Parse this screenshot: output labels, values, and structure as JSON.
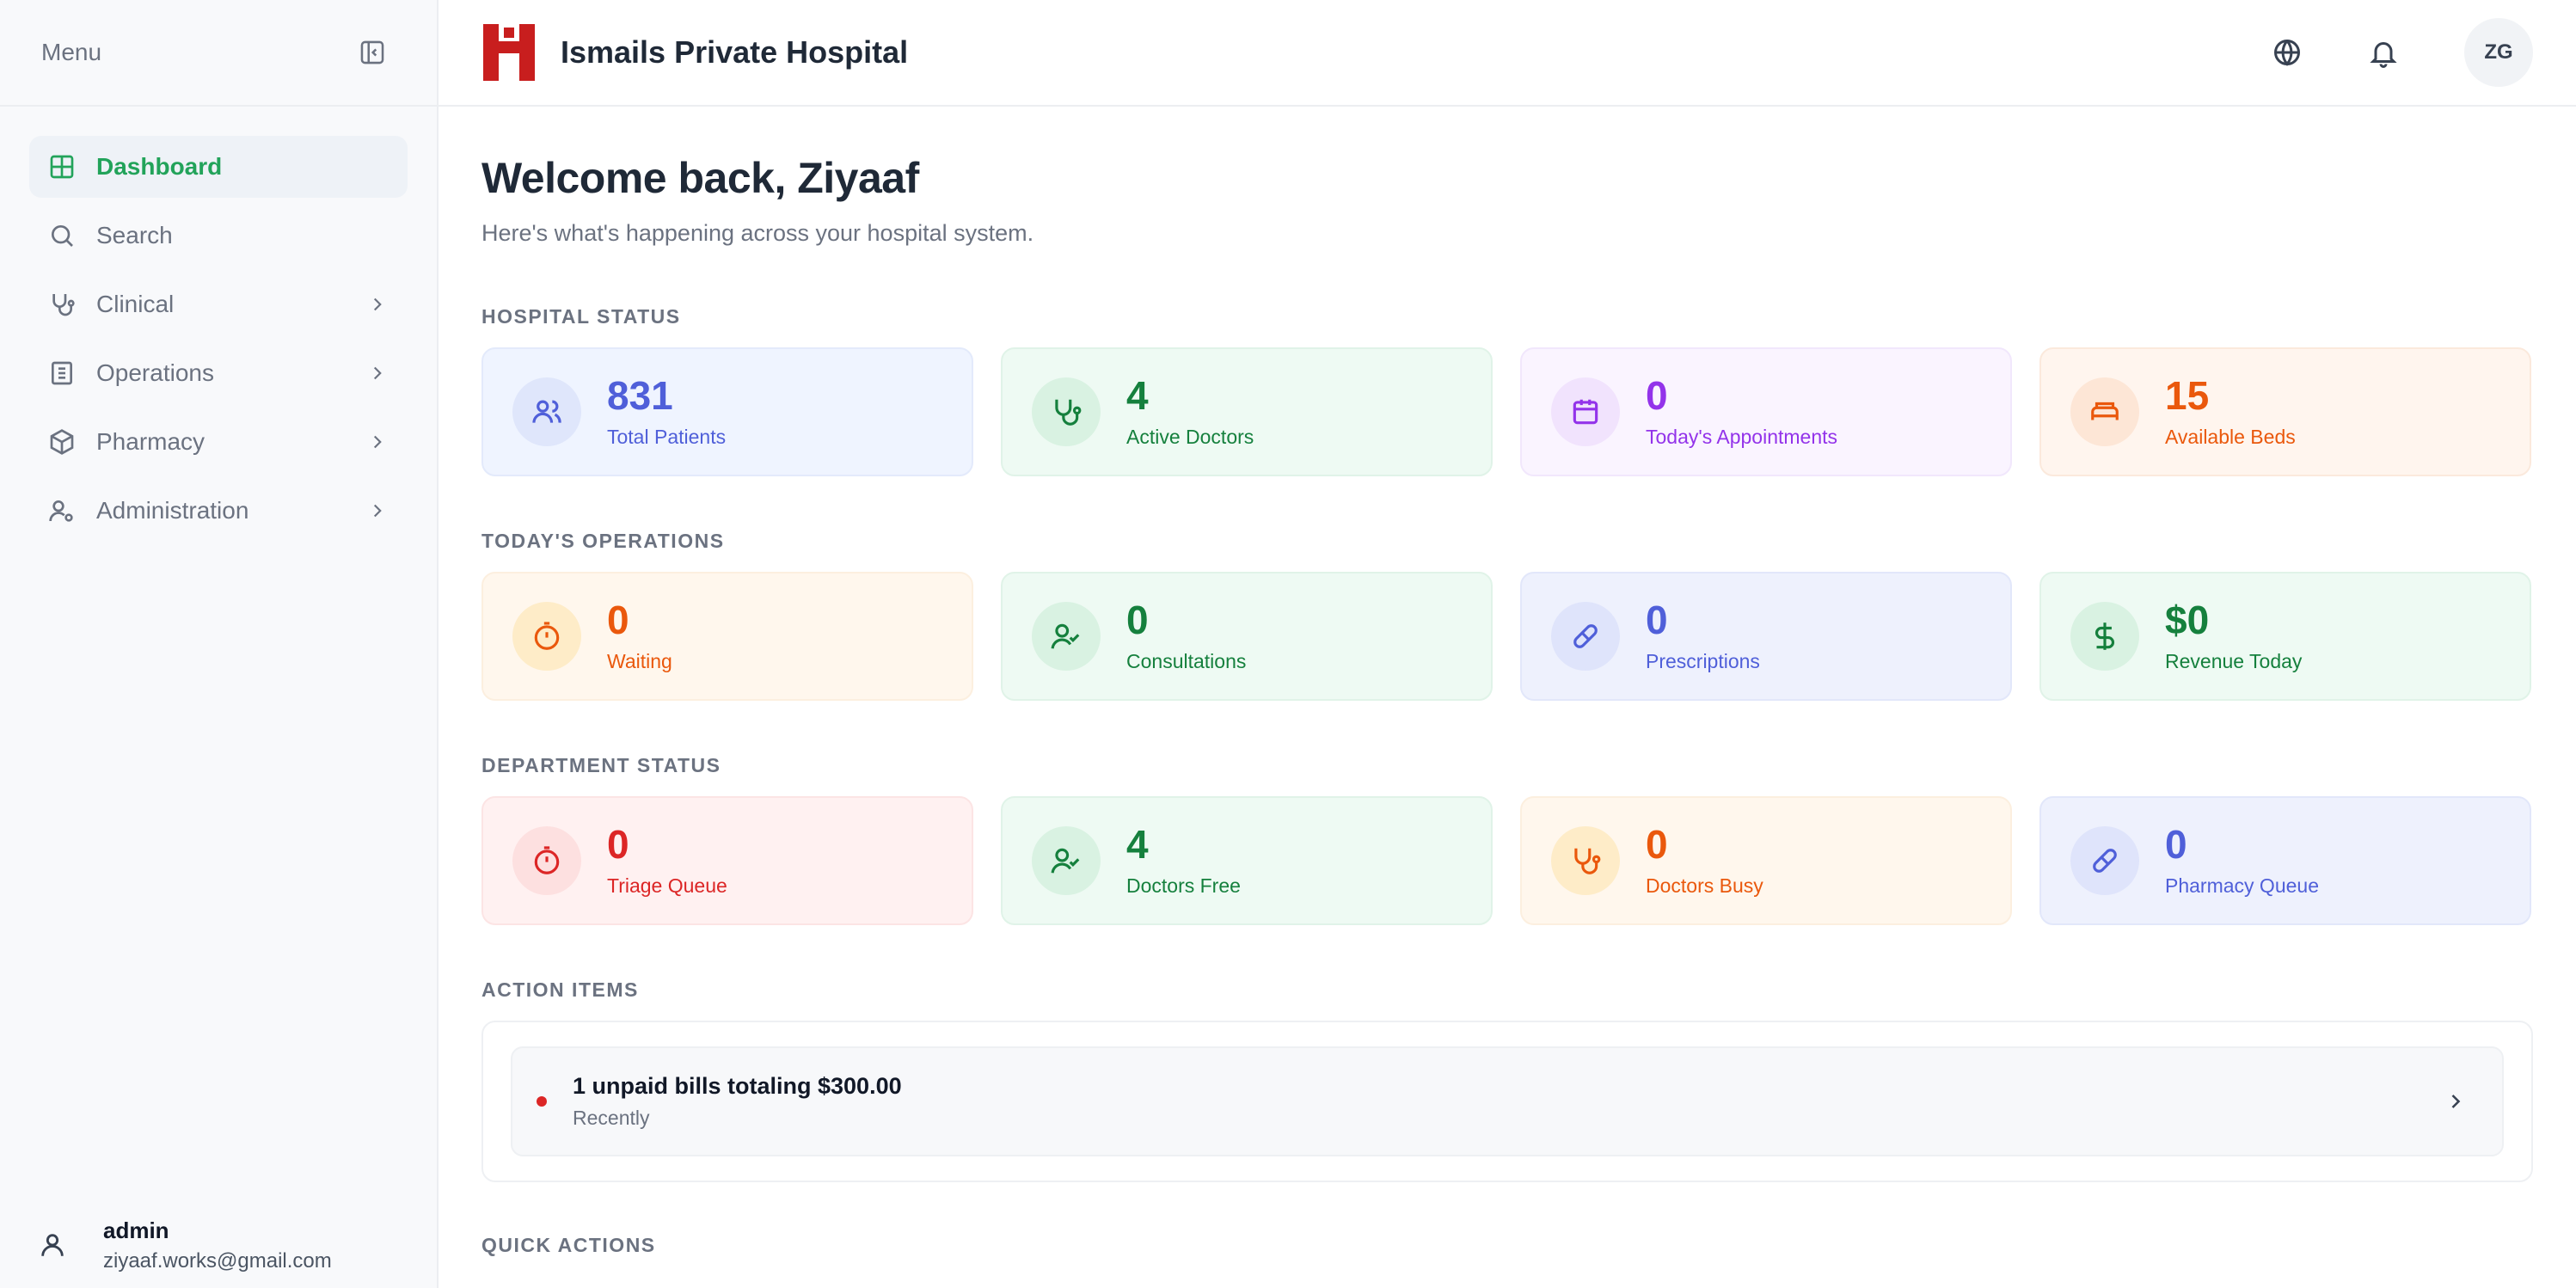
{
  "sidebar": {
    "menu_label": "Menu",
    "items": [
      {
        "label": "Dashboard",
        "icon": "dashboard-icon",
        "active": true
      },
      {
        "label": "Search",
        "icon": "search-icon"
      },
      {
        "label": "Clinical",
        "icon": "stethoscope-icon"
      },
      {
        "label": "Operations",
        "icon": "building-icon"
      },
      {
        "label": "Pharmacy",
        "icon": "box-icon"
      },
      {
        "label": "Administration",
        "icon": "user-cog-icon"
      }
    ],
    "user": {
      "name": "admin",
      "email": "ziyaaf.works@gmail.com"
    }
  },
  "header": {
    "title": "Ismails Private Hospital",
    "avatar_initials": "ZG"
  },
  "welcome": {
    "title": "Welcome back, Ziyaaf",
    "subtitle": "Here's what's happening across your hospital system."
  },
  "hospital_status": {
    "label": "HOSPITAL STATUS",
    "cards": [
      {
        "value": "831",
        "label": "Total Patients",
        "icon": "users-icon",
        "color": "#4f5fd9"
      },
      {
        "value": "4",
        "label": "Active Doctors",
        "icon": "stethoscope-icon",
        "color": "#15803d"
      },
      {
        "value": "0",
        "label": "Today's Appointments",
        "icon": "calendar-icon",
        "color": "#9333ea"
      },
      {
        "value": "15",
        "label": "Available Beds",
        "icon": "bed-icon",
        "color": "#ea580c"
      }
    ]
  },
  "todays_operations": {
    "label": "TODAY'S OPERATIONS",
    "cards": [
      {
        "value": "0",
        "label": "Waiting",
        "icon": "timer-icon",
        "color": "#ea580c"
      },
      {
        "value": "0",
        "label": "Consultations",
        "icon": "user-check-icon",
        "color": "#15803d"
      },
      {
        "value": "0",
        "label": "Prescriptions",
        "icon": "pill-icon",
        "color": "#4f5fd9"
      },
      {
        "value": "$0",
        "label": "Revenue Today",
        "icon": "dollar-icon",
        "color": "#15803d"
      }
    ]
  },
  "department_status": {
    "label": "DEPARTMENT STATUS",
    "cards": [
      {
        "value": "0",
        "label": "Triage Queue",
        "icon": "timer-icon",
        "color": "#dc2626"
      },
      {
        "value": "4",
        "label": "Doctors Free",
        "icon": "user-check-icon",
        "color": "#15803d"
      },
      {
        "value": "0",
        "label": "Doctors Busy",
        "icon": "stethoscope-icon",
        "color": "#ea580c"
      },
      {
        "value": "0",
        "label": "Pharmacy Queue",
        "icon": "pill-icon",
        "color": "#4f5fd9"
      }
    ]
  },
  "action_items": {
    "label": "ACTION ITEMS",
    "items": [
      {
        "title": "1 unpaid bills totaling $300.00",
        "subtitle": "Recently"
      }
    ]
  },
  "quick_actions": {
    "label": "QUICK ACTIONS"
  }
}
